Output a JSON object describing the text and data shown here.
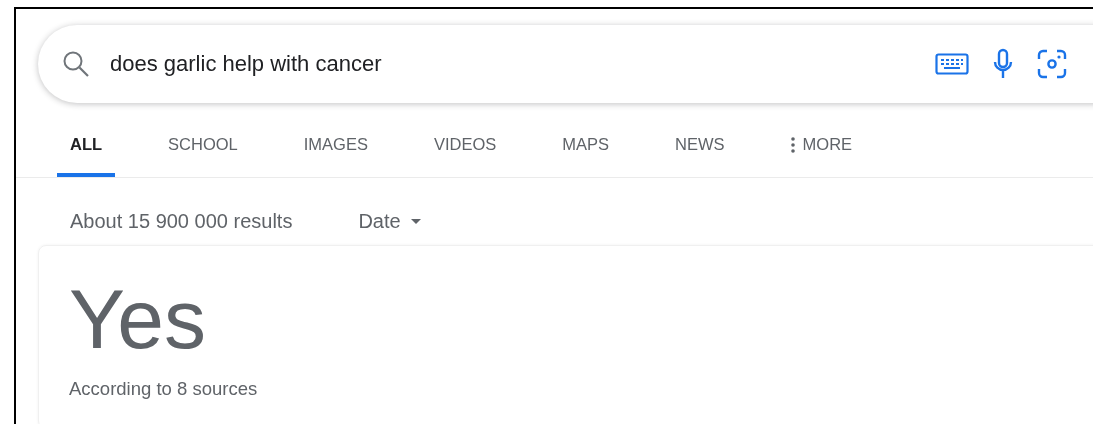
{
  "search": {
    "query": "does garlic help with cancer"
  },
  "tabs": [
    {
      "label": "ALL",
      "selected": true
    },
    {
      "label": "SCHOOL",
      "selected": false
    },
    {
      "label": "IMAGES",
      "selected": false
    },
    {
      "label": "VIDEOS",
      "selected": false
    },
    {
      "label": "MAPS",
      "selected": false
    },
    {
      "label": "NEWS",
      "selected": false
    },
    {
      "label": "MORE",
      "selected": false,
      "kind": "menu"
    }
  ],
  "result_stats": "About 15 900 000 results",
  "date_filter": {
    "label": "Date"
  },
  "answer": {
    "title": "Yes",
    "subtitle": "According to 8 sources"
  }
}
